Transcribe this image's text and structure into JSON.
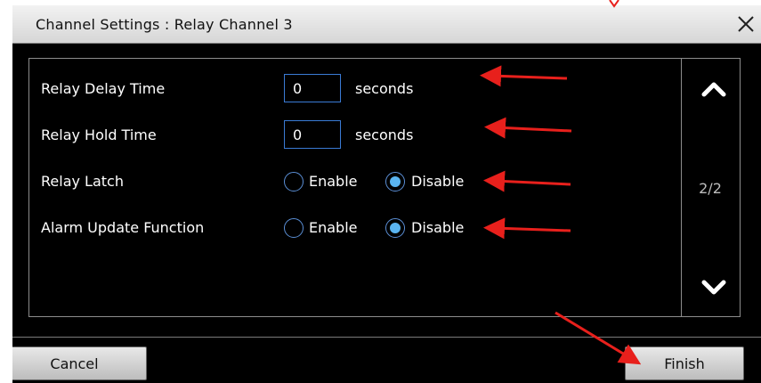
{
  "dialog": {
    "title": "Channel Settings : Relay Channel 3"
  },
  "fields": {
    "relay_delay": {
      "label": "Relay Delay Time",
      "value": "0",
      "unit": "seconds"
    },
    "relay_hold": {
      "label": "Relay Hold Time",
      "value": "0",
      "unit": "seconds"
    },
    "relay_latch": {
      "label": "Relay Latch",
      "option_enable": "Enable",
      "option_disable": "Disable",
      "selected": "Disable"
    },
    "alarm_update": {
      "label": "Alarm Update Function",
      "option_enable": "Enable",
      "option_disable": "Disable",
      "selected": "Disable"
    }
  },
  "pager": {
    "indicator": "2/2"
  },
  "buttons": {
    "cancel": "Cancel",
    "finish": "Finish"
  },
  "icons": {
    "close": "close-icon",
    "scroll_up": "chevron-up-icon",
    "scroll_down": "chevron-down-icon",
    "radio_checked": "radio-checked-icon",
    "radio_unchecked": "radio-unchecked-icon"
  },
  "colors": {
    "background": "#000000",
    "accent": "#5ab4f0",
    "input_border": "#3a7bd5",
    "annotation_arrow": "#e8201c"
  }
}
